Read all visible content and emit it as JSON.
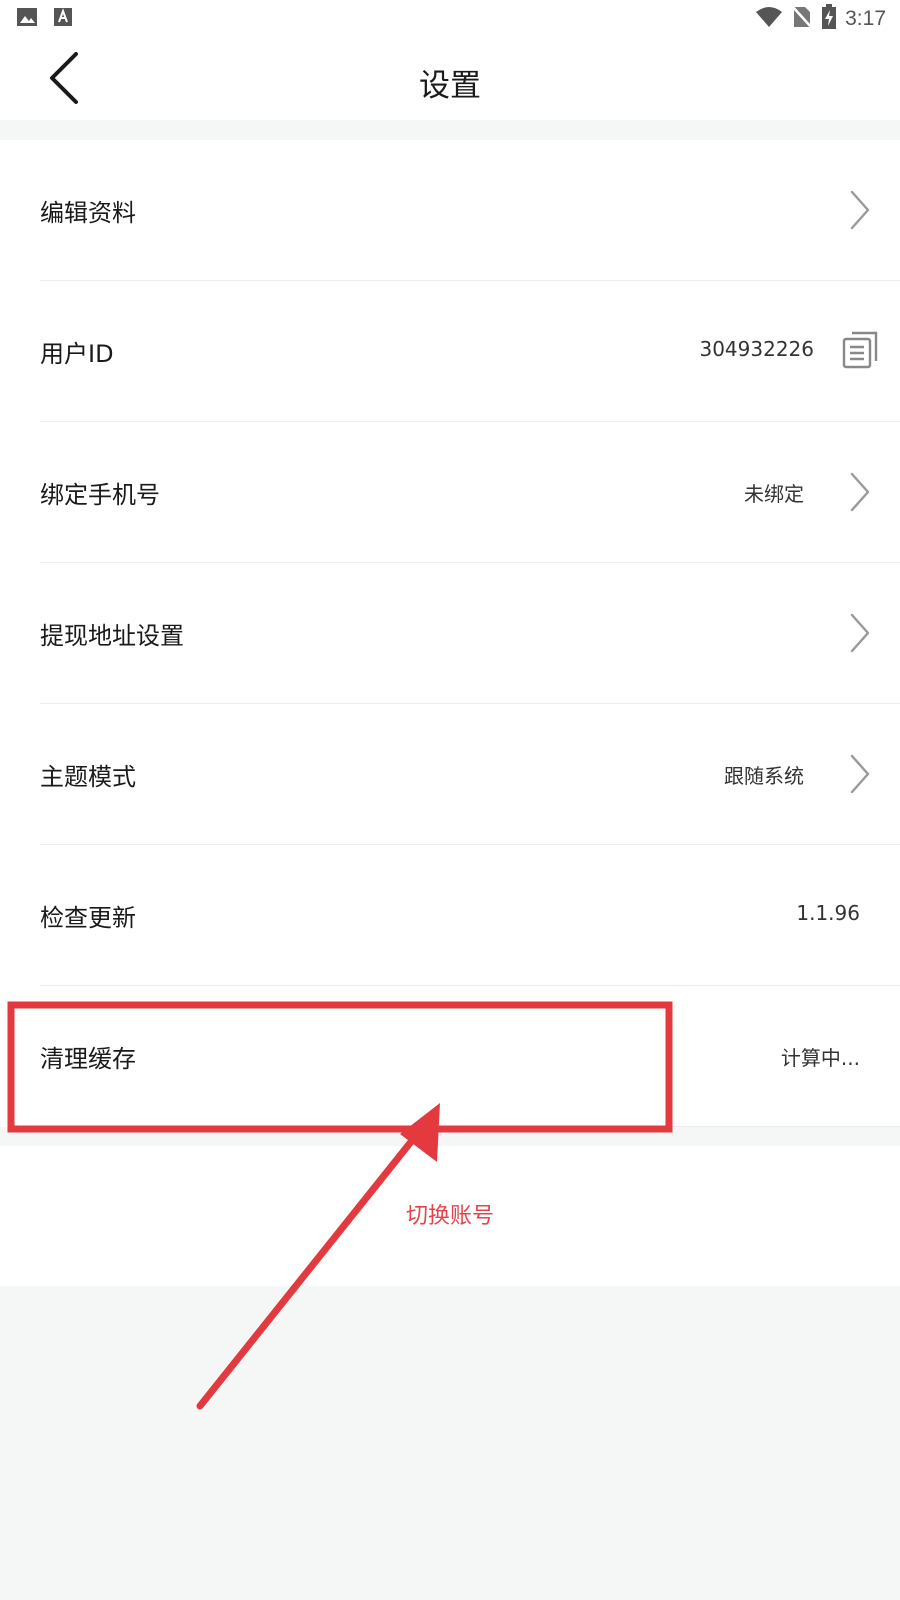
{
  "status_bar": {
    "time": "3:17",
    "left_icons": [
      "image-icon",
      "text-a-icon"
    ],
    "right_icons": [
      "wifi-icon",
      "no-sim-icon",
      "battery-charging-icon"
    ]
  },
  "header": {
    "title": "设置",
    "back_icon": "chevron-left-icon"
  },
  "settings": [
    {
      "label": "编辑资料",
      "value": "",
      "trailing": "chevron-right-icon"
    },
    {
      "label": "用户ID",
      "value": "304932226",
      "trailing": "copy-icon"
    },
    {
      "label": "绑定手机号",
      "value": "未绑定",
      "trailing": "chevron-right-icon"
    },
    {
      "label": "提现地址设置",
      "value": "",
      "trailing": "chevron-right-icon"
    },
    {
      "label": "主题模式",
      "value": "跟随系统",
      "trailing": "chevron-right-icon"
    },
    {
      "label": "检查更新",
      "value": "1.1.96",
      "trailing": ""
    },
    {
      "label": "清理缓存",
      "value": "计算中...",
      "trailing": ""
    }
  ],
  "switch_account_label": "切换账号",
  "colors": {
    "accent_red": "#e4454d",
    "annotation_red": "#e23a3f",
    "background": "#f5f6f6",
    "card": "#ffffff"
  }
}
